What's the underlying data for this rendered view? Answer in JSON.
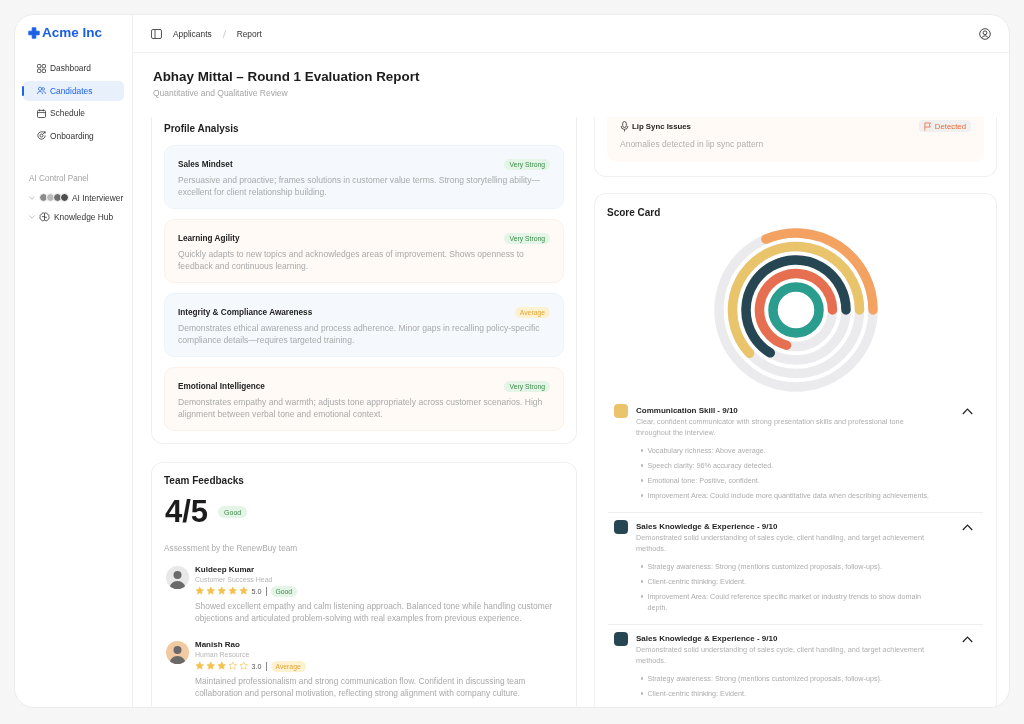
{
  "sidebar": {
    "brand": "Acme Inc",
    "nav": [
      {
        "label": "Dashboard",
        "selected": false
      },
      {
        "label": "Candidates",
        "selected": true
      },
      {
        "label": "Schedule",
        "selected": false
      },
      {
        "label": "Onboarding",
        "selected": false
      }
    ],
    "section_title": "AI Control Panel",
    "groups": [
      {
        "label": "AI Interviewer"
      },
      {
        "label": "Knowledge Hub"
      }
    ]
  },
  "header": {
    "breadcrumb": [
      "Applicants",
      "Report"
    ]
  },
  "page": {
    "title": "Abhay Mittal – Round 1 Evaluation Report",
    "subtitle": "Quantitative and Qualitative Review"
  },
  "profile_analysis": {
    "title": "Profile Analysis",
    "items": [
      {
        "title": "Sales Mindset",
        "badge": {
          "label": "Very Strong",
          "kind": "positive"
        },
        "description": "Persuasive and proactive; frames solutions in customer value terms. Strong storytelling ability—excellent for client relationship building."
      },
      {
        "title": "Learning Agility",
        "badge": {
          "label": "Very Strong",
          "kind": "positive"
        },
        "description": "Quickly adapts to new topics and acknowledges areas of improvement. Shows openness to feedback and continuous learning."
      },
      {
        "title": "Integrity & Compliance Awareness",
        "badge": {
          "label": "Average",
          "kind": "warning"
        },
        "description": "Demonstrates ethical awareness and process adherence. Minor gaps in recalling policy-specific compliance details—requires targeted training."
      },
      {
        "title": "Emotional Intelligence",
        "badge": {
          "label": "Very Strong",
          "kind": "positive"
        },
        "description": "Demonstrates empathy and warmth; adjusts tone appropriately across customer scenarios. High alignment between verbal tone and emotional context."
      }
    ]
  },
  "team_feedback": {
    "title": "Team Feedbacks",
    "score": "4/5",
    "badge": {
      "label": "Good",
      "kind": "positive"
    },
    "note": "Assessment by the RenewBuy team",
    "reviews": [
      {
        "name": "Kuldeep Kumar",
        "role": "Customer Success Head",
        "color": "#e8e8e8",
        "stars": 5,
        "rating": "5.0",
        "badge": {
          "label": "Good",
          "kind": "positive"
        },
        "comment": "Showed excellent empathy and calm listening approach. Balanced tone while handling customer objections and articulated problem-solving with real examples from previous experience."
      },
      {
        "name": "Manish Rao",
        "role": "Human Resource",
        "color": "#f3c9a1",
        "stars": 3,
        "rating": "3.0",
        "badge": {
          "label": "Average",
          "kind": "warning"
        },
        "comment": "Maintained professionalism and strong communication flow. Confident in discussing team collaboration and personal motivation, reflecting strong alignment with company culture."
      }
    ]
  },
  "integrity_checks": {
    "items": [
      {
        "title": "Lip Sync Issues",
        "status": {
          "label": "Detected",
          "kind": "alert"
        },
        "description": "Anomalies detected in lip sync pattern"
      }
    ]
  },
  "score_card": {
    "title": "Score Card",
    "items": [
      {
        "color": "#e9c46a",
        "title": "Communication Skill - 9/10",
        "description": "Clear, confident communicator with strong presentation skills and professional tone throughout the interview.",
        "expanded": true,
        "points": [
          "Vocabulary richness: Above average.",
          "Speech clarity: 96% accuracy detected.",
          "Emotional tone: Positive, confident.",
          "Improvement Area: Could include more quantitative data when describing achievements."
        ]
      },
      {
        "color": "#264653",
        "title": "Sales Knowledge & Experience - 9/10",
        "description": "Demonstrated solid understanding of sales cycle, client handling, and target achievement methods.",
        "expanded": true,
        "points": [
          "Strategy awareness: Strong (mentions customized proposals, follow-ups).",
          "Client-centric thinking: Evident.",
          "Improvement Area: Could reference specific market or industry trends to show domain depth."
        ]
      },
      {
        "color": "#264653",
        "title": "Sales Knowledge & Experience - 9/10",
        "description": "Demonstrated solid understanding of sales cycle, client handling, and target achievement methods.",
        "expanded": true,
        "points": [
          "Strategy awareness: Strong (mentions customized proposals, follow-ups).",
          "Client-centric thinking: Evident."
        ]
      }
    ]
  }
}
